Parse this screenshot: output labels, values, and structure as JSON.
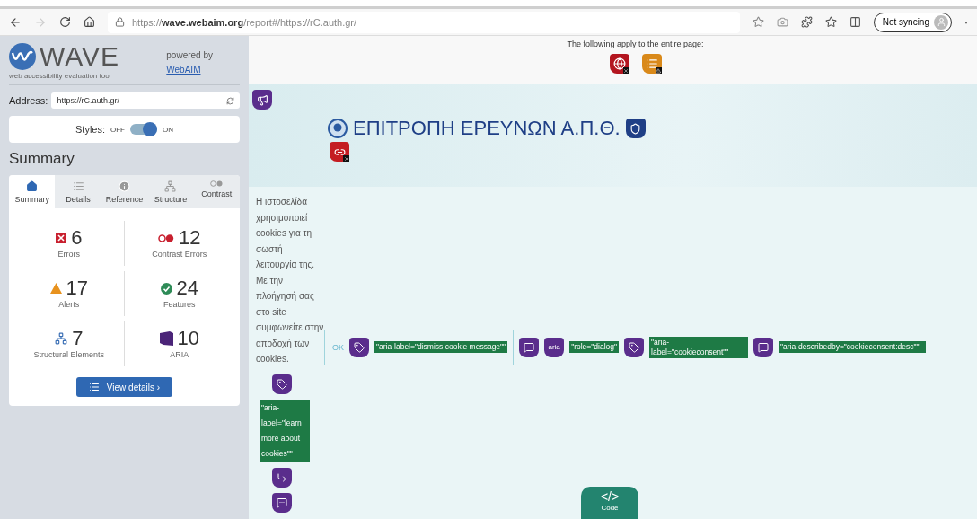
{
  "browser": {
    "url": "https://**wave.webaim.org**/report#/https://rC.auth.gr/",
    "profile_button": "Not syncing",
    "more": "·"
  },
  "sidebar": {
    "logo": "WAVE",
    "tagline": "web accessibility evaluation tool",
    "powered_by": "powered by",
    "powered_link": "WebAIM",
    "address_label": "Address:",
    "address_value": "https://rC.auth.gr/",
    "styles": {
      "label": "Styles:",
      "off_label": "OFF",
      "on_label": "ON",
      "on": true
    },
    "heading": "Summary",
    "tabs": [
      {
        "kind": "summary",
        "label": "Summary",
        "selected": true
      },
      {
        "kind": "details",
        "label": "Details",
        "selected": false
      },
      {
        "kind": "reference",
        "label": "Reference",
        "selected": false
      },
      {
        "kind": "structure",
        "label": "Structure",
        "selected": false
      },
      {
        "kind": "contrast",
        "label": "Contrast",
        "selected": false
      }
    ],
    "stats": [
      {
        "kind": "errors",
        "count": "6",
        "label": "Errors"
      },
      {
        "kind": "contrast",
        "count": "12",
        "label": "Contrast Errors"
      },
      {
        "kind": "alerts",
        "count": "17",
        "label": "Alerts"
      },
      {
        "kind": "features",
        "count": "24",
        "label": "Features"
      },
      {
        "kind": "structure",
        "count": "7",
        "label": "Structural Elements"
      },
      {
        "kind": "aria",
        "count": "10",
        "label": "ARIA"
      }
    ],
    "view_details": "View details ›"
  },
  "page": {
    "notice": "The following apply to the entire page:",
    "title": "ΕΠΙΤΡΟΠΗ ΕΡΕΥΝΩΝ Α.Π.Θ.",
    "cookie_text": "Η ιστοσελίδα χρησιμοποιεί cookies για τη σωστή λειτουργία της. Με την πλοήγησή σας στο site συμφωνείτε στην αποδοχή των cookies.",
    "ok_button": "OK",
    "dismiss_label": "\"aria-label=\"dismiss cookie message\"\"",
    "aria_badge": "aria",
    "role_label": "\"role=\"dialog\"",
    "consent_label": "\"aria-label=\"cookieconsent\"\"",
    "describedby_label": "\"aria-describedby=\"cookieconsent:desc\"\"",
    "learn_label": "\"aria-label=\"learn more about cookies\"\"",
    "code_button": {
      "symbol": "</>",
      "label": "Code"
    }
  }
}
